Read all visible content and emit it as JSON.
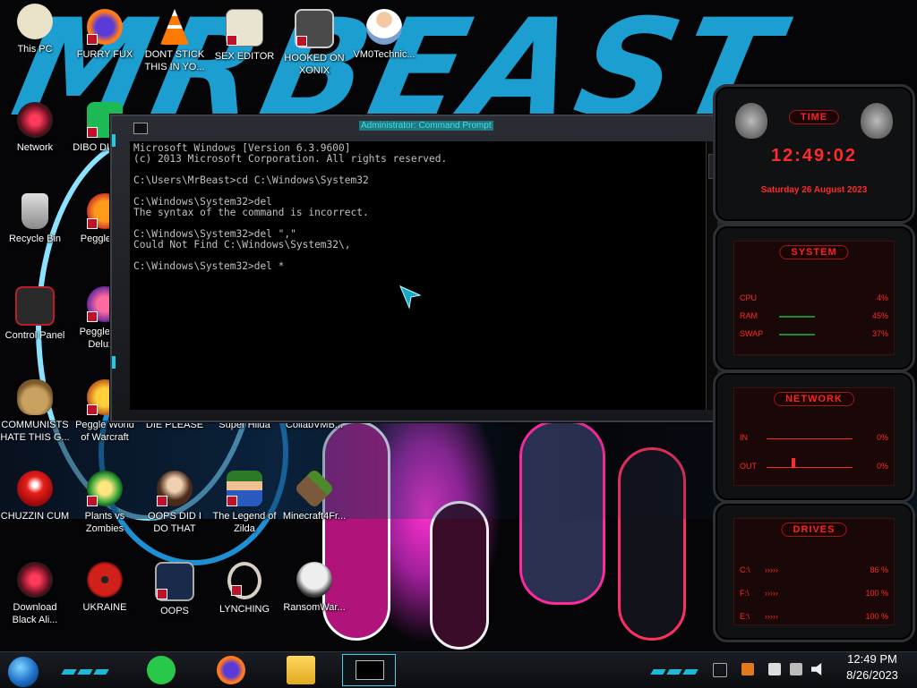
{
  "desktop": {
    "icons": [
      {
        "label": "This PC"
      },
      {
        "label": "FURRY FUX"
      },
      {
        "label": "DONT STICK THIS IN YO..."
      },
      {
        "label": "SEX EDITOR"
      },
      {
        "label": "HOOKED ON XONIX"
      },
      {
        "label": "VM0Technic..."
      },
      {
        "label": "Network"
      },
      {
        "label": "DIBO DUMB..."
      },
      {
        "label": "Recycle Bin"
      },
      {
        "label": "Peggle D..."
      },
      {
        "label": "Control Panel"
      },
      {
        "label": "Peggle Ni... Delux..."
      },
      {
        "label": "COMMUNISTS HATE THIS G..."
      },
      {
        "label": "Peggle World of Warcraft"
      },
      {
        "label": "DIE PLEASE"
      },
      {
        "label": "Super Hilda"
      },
      {
        "label": "CollabVMB..."
      },
      {
        "label": "CHUZZIN CUM"
      },
      {
        "label": "Plants vs Zombies"
      },
      {
        "label": "OOPS DID I DO THAT"
      },
      {
        "label": "The Legend of Zilda"
      },
      {
        "label": "Minecraft4Fr..."
      },
      {
        "label": "Download Black Ali..."
      },
      {
        "label": "UKRAINE"
      },
      {
        "label": "OOPS"
      },
      {
        "label": "LYNCHING"
      },
      {
        "label": "RansomWar..."
      }
    ]
  },
  "cmd": {
    "title": "Administrator: Command Prompt",
    "output": "Microsoft Windows [Version 6.3.9600]\n(c) 2013 Microsoft Corporation. All rights reserved.\n\nC:\\Users\\MrBeast>cd C:\\Windows\\System32\n\nC:\\Windows\\System32>del\nThe syntax of the command is incorrect.\n\nC:\\Windows\\System32>del \",\"\nCould Not Find C:\\Windows\\System32\\,\n\nC:\\Windows\\System32>del *"
  },
  "gadgets": {
    "time": {
      "title": "TIME",
      "clock": "12:49:02",
      "date": "Saturday 26 August 2023"
    },
    "system": {
      "title": "SYSTEM",
      "rows": [
        {
          "key": "CPU",
          "value": "4%"
        },
        {
          "key": "RAM",
          "value": "45%"
        },
        {
          "key": "SWAP",
          "value": "37%"
        }
      ]
    },
    "network": {
      "title": "NETWORK",
      "rows": [
        {
          "key": "IN",
          "value": "0%"
        },
        {
          "key": "OUT",
          "value": "0%"
        }
      ]
    },
    "drives": {
      "title": "DRIVES",
      "rows": [
        {
          "key": "C:\\",
          "value": "86 %"
        },
        {
          "key": "F:\\",
          "value": "100 %"
        },
        {
          "key": "E:\\",
          "value": "100 %"
        }
      ]
    }
  },
  "taskbar": {
    "clock_time": "12:49 PM",
    "clock_date": "8/26/2023"
  },
  "colors": {
    "gadget_red": "#ff2a2a",
    "accent_cyan": "#1fb8d8",
    "console_text": "#c0c0c0"
  }
}
